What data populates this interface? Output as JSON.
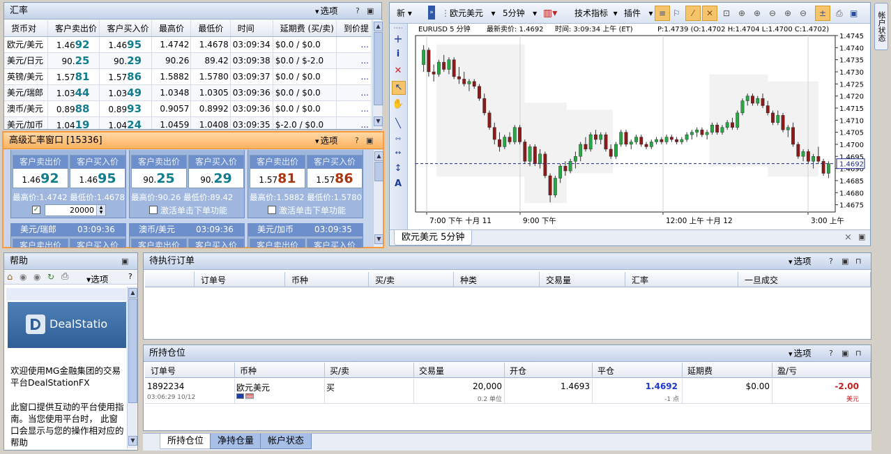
{
  "colors": {
    "accent": "#316ac5",
    "bid_color": "#117d8d",
    "ask_color": "#a83612",
    "bull": "#28a745",
    "bear": "#8b1a1a",
    "advanced_border": "#ff9a3c"
  },
  "rates_panel": {
    "title": "汇率",
    "options": "选项",
    "columns": [
      "货币对",
      "客户卖出价",
      "客户买入价",
      "最高价",
      "最低价",
      "时间",
      "延期费 (买/卖)",
      "到价提"
    ],
    "rows": [
      {
        "pair": "欧元/美元",
        "bid_pre": "1.46",
        "bid_big": "92",
        "ask_pre": "1.46",
        "ask_big": "95",
        "high": "1.4742",
        "low": "1.4678",
        "time": "03:09:34",
        "rollover": "$0.0 / $0.0",
        "alert": "..."
      },
      {
        "pair": "美元/日元",
        "bid_pre": "90.",
        "bid_big": "25",
        "ask_pre": "90.",
        "ask_big": "29",
        "high": "90.26",
        "low": "89.42",
        "time": "03:09:38",
        "rollover": "$0.0 / $-2.0",
        "alert": "..."
      },
      {
        "pair": "英镑/美元",
        "bid_pre": "1.57",
        "bid_big": "81",
        "ask_pre": "1.57",
        "ask_big": "86",
        "high": "1.5882",
        "low": "1.5780",
        "time": "03:09:37",
        "rollover": "$0.0 / $0.0",
        "alert": "..."
      },
      {
        "pair": "美元/瑞郎",
        "bid_pre": "1.03",
        "bid_big": "44",
        "ask_pre": "1.03",
        "ask_big": "49",
        "high": "1.0348",
        "low": "1.0305",
        "time": "03:09:36",
        "rollover": "$0.0 / $0.0",
        "alert": "..."
      },
      {
        "pair": "澳币/美元",
        "bid_pre": "0.89",
        "bid_big": "88",
        "ask_pre": "0.89",
        "ask_big": "93",
        "high": "0.9057",
        "low": "0.8992",
        "time": "03:09:36",
        "rollover": "$0.0 / $0.0",
        "alert": "..."
      },
      {
        "pair": "美元/加币",
        "bid_pre": "1.04",
        "bid_big": "19",
        "ask_pre": "1.04",
        "ask_big": "24",
        "high": "1.0459",
        "low": "1.0408",
        "time": "03:09:35",
        "rollover": "$-2.0 / $0.0",
        "alert": "..."
      }
    ]
  },
  "adv_panel": {
    "title": "高级汇率窗口 [15336]",
    "options": "选项",
    "sell_label": "客户卖出价",
    "buy_label": "客户买入价",
    "tiles": [
      {
        "bid_pre": "1.46",
        "bid_big": "92",
        "ask_pre": "1.46",
        "ask_big": "95",
        "hilo": "最高价:1.4742  最低价:1.4678",
        "checked": true,
        "amount": "20000"
      },
      {
        "bid_pre": "90.",
        "bid_big": "25",
        "ask_pre": "90.",
        "ask_big": "29",
        "hilo": "最高价:90.26  最低价:89.42",
        "checked": false,
        "activate": "激活单击下单功能"
      },
      {
        "bid_pre": "1.57",
        "bid_big": "81",
        "ask_pre": "1.57",
        "ask_big": "86",
        "hilo": "最高价:1.5882  最低价:1.5780",
        "checked": false,
        "activate": "激活单击下单功能"
      }
    ],
    "row2": [
      {
        "pair": "美元/瑞郎",
        "time": "03:09:36"
      },
      {
        "pair": "澳币/美元",
        "time": "03:09:36"
      },
      {
        "pair": "美元/加币",
        "time": "03:09:35"
      }
    ]
  },
  "help_panel": {
    "title": "帮助",
    "options": "选项",
    "logo_text": "DealStatio",
    "para1": "欢迎使用MG金融集团的交易平台DealStationFX",
    "para2": "此窗口提供互动的平台使用指南。当您使用平台时， 此窗口会显示与您的操作相对应的帮助"
  },
  "chart_toolbar": {
    "new": "新",
    "symbol": "欧元美元",
    "interval": "5分钟",
    "indicators": "技术指标",
    "plugins": "插件"
  },
  "chart_data": {
    "type": "candlestick",
    "title": "EURUSD  5 分钟",
    "latest": "最新卖价: 1.4692",
    "time_info": "时间: 3:09:34 上午 (ET)",
    "ohlc_info": "P:1.4739 (O:1.4702 H:1.4704 L:1.4700 C:1.4702)",
    "ylim": [
      1.4672,
      1.4745
    ],
    "yticks": [
      "1.4745",
      "1.4740",
      "1.4735",
      "1.4730",
      "1.4725",
      "1.4720",
      "1.4715",
      "1.4710",
      "1.4705",
      "1.4700",
      "1.4695",
      "1.4690",
      "1.4685",
      "1.4680",
      "1.4675"
    ],
    "current_price": "1.4692",
    "xticks": [
      "7:00 下午 十月 11",
      "9:00 下午",
      "12:00 上午 十月 12",
      "3:00 上午"
    ],
    "candles": [
      [
        1.4733,
        1.4741,
        1.473,
        1.4739
      ],
      [
        1.4739,
        1.474,
        1.4728,
        1.473
      ],
      [
        1.473,
        1.4733,
        1.4726,
        1.4729
      ],
      [
        1.4729,
        1.4735,
        1.4728,
        1.4734
      ],
      [
        1.4734,
        1.4737,
        1.473,
        1.4731
      ],
      [
        1.4731,
        1.4736,
        1.4729,
        1.4735
      ],
      [
        1.4735,
        1.4736,
        1.4727,
        1.4728
      ],
      [
        1.4728,
        1.4732,
        1.4725,
        1.4727
      ],
      [
        1.4727,
        1.473,
        1.4724,
        1.4725
      ],
      [
        1.4725,
        1.4727,
        1.4722,
        1.4726
      ],
      [
        1.4726,
        1.4727,
        1.4723,
        1.4724
      ],
      [
        1.4724,
        1.4725,
        1.4718,
        1.4719
      ],
      [
        1.4719,
        1.4721,
        1.4712,
        1.4713
      ],
      [
        1.4713,
        1.4714,
        1.4706,
        1.4707
      ],
      [
        1.4707,
        1.4709,
        1.47,
        1.4702
      ],
      [
        1.4702,
        1.4705,
        1.4697,
        1.4699
      ],
      [
        1.4699,
        1.4704,
        1.4698,
        1.4703
      ],
      [
        1.4703,
        1.4705,
        1.47,
        1.4701
      ],
      [
        1.4701,
        1.4708,
        1.47,
        1.4707
      ],
      [
        1.4707,
        1.4708,
        1.47,
        1.4701
      ],
      [
        1.4701,
        1.4702,
        1.4692,
        1.4693
      ],
      [
        1.4693,
        1.47,
        1.4691,
        1.4699
      ],
      [
        1.4699,
        1.47,
        1.4691,
        1.4692
      ],
      [
        1.4692,
        1.4698,
        1.469,
        1.4696
      ],
      [
        1.4696,
        1.4697,
        1.4686,
        1.4687
      ],
      [
        1.4687,
        1.4688,
        1.4676,
        1.4679
      ],
      [
        1.4679,
        1.4687,
        1.4678,
        1.4686
      ],
      [
        1.4686,
        1.4692,
        1.4684,
        1.4691
      ],
      [
        1.4691,
        1.4693,
        1.4687,
        1.4689
      ],
      [
        1.4689,
        1.4694,
        1.4688,
        1.4693
      ],
      [
        1.4693,
        1.4697,
        1.469,
        1.4695
      ],
      [
        1.4695,
        1.4701,
        1.4693,
        1.47
      ],
      [
        1.47,
        1.4703,
        1.4697,
        1.4698
      ],
      [
        1.4698,
        1.4705,
        1.4697,
        1.4704
      ],
      [
        1.4704,
        1.4706,
        1.47,
        1.4702
      ],
      [
        1.4702,
        1.4705,
        1.47,
        1.4704
      ],
      [
        1.4704,
        1.4705,
        1.4697,
        1.4698
      ],
      [
        1.4698,
        1.47,
        1.4694,
        1.4695
      ],
      [
        1.4695,
        1.4701,
        1.4694,
        1.47
      ],
      [
        1.47,
        1.4706,
        1.4699,
        1.4705
      ],
      [
        1.4705,
        1.4706,
        1.4699,
        1.47
      ],
      [
        1.47,
        1.4702,
        1.4698,
        1.4701
      ],
      [
        1.4701,
        1.4704,
        1.47,
        1.4703
      ],
      [
        1.4703,
        1.4704,
        1.4699,
        1.47
      ],
      [
        1.47,
        1.4701,
        1.4698,
        1.4699
      ],
      [
        1.4699,
        1.4702,
        1.4698,
        1.4701
      ],
      [
        1.4701,
        1.4703,
        1.47,
        1.4702
      ],
      [
        1.4702,
        1.4703,
        1.47,
        1.4701
      ],
      [
        1.4701,
        1.4704,
        1.47,
        1.4703
      ],
      [
        1.4703,
        1.4704,
        1.4701,
        1.4702
      ],
      [
        1.4702,
        1.4703,
        1.47,
        1.4701
      ],
      [
        1.4701,
        1.4703,
        1.47,
        1.4702
      ],
      [
        1.4702,
        1.4705,
        1.4701,
        1.4704
      ],
      [
        1.4704,
        1.4706,
        1.4702,
        1.4705
      ],
      [
        1.4705,
        1.4707,
        1.4703,
        1.4706
      ],
      [
        1.4706,
        1.4707,
        1.4703,
        1.4704
      ],
      [
        1.4704,
        1.4706,
        1.4702,
        1.4705
      ],
      [
        1.4705,
        1.4709,
        1.4704,
        1.4708
      ],
      [
        1.4708,
        1.4709,
        1.4704,
        1.4705
      ],
      [
        1.4705,
        1.4708,
        1.4704,
        1.4707
      ],
      [
        1.4707,
        1.471,
        1.4706,
        1.4709
      ],
      [
        1.4709,
        1.4711,
        1.4706,
        1.4707
      ],
      [
        1.4707,
        1.4714,
        1.4706,
        1.4713
      ],
      [
        1.4713,
        1.4719,
        1.4712,
        1.4718
      ],
      [
        1.4718,
        1.4721,
        1.4716,
        1.472
      ],
      [
        1.472,
        1.4721,
        1.4716,
        1.4717
      ],
      [
        1.4717,
        1.472,
        1.4716,
        1.4719
      ],
      [
        1.4719,
        1.4721,
        1.4715,
        1.4716
      ],
      [
        1.4716,
        1.4718,
        1.4712,
        1.4713
      ],
      [
        1.4713,
        1.4714,
        1.4708,
        1.4709
      ],
      [
        1.4709,
        1.4714,
        1.4708,
        1.4712
      ],
      [
        1.4712,
        1.4713,
        1.4705,
        1.4706
      ],
      [
        1.4706,
        1.4708,
        1.4703,
        1.4707
      ],
      [
        1.4707,
        1.4709,
        1.4699,
        1.47
      ],
      [
        1.47,
        1.4701,
        1.4694,
        1.4695
      ],
      [
        1.4695,
        1.4698,
        1.4693,
        1.4697
      ],
      [
        1.4697,
        1.4698,
        1.4692,
        1.4693
      ],
      [
        1.4693,
        1.4696,
        1.469,
        1.4695
      ],
      [
        1.4695,
        1.4699,
        1.4692,
        1.4693
      ],
      [
        1.4693,
        1.4694,
        1.4687,
        1.4688
      ],
      [
        1.4688,
        1.4693,
        1.4686,
        1.4692
      ]
    ]
  },
  "chart_tab": "欧元美元 5分钟",
  "orders_panel": {
    "title": "待执行订单",
    "options": "选项",
    "columns": [
      "订单号",
      "币种",
      "买/卖",
      "种类",
      "交易量",
      "汇率",
      "一旦成交"
    ]
  },
  "positions_panel": {
    "title": "所持仓位",
    "options": "选项",
    "columns": [
      "订单号",
      "币种",
      "买/卖",
      "交易量",
      "开仓",
      "平仓",
      "延期费",
      "盈/亏"
    ],
    "row": {
      "order_no": "1892234",
      "timestamp": "03:06:29 10/12",
      "currency": "欧元美元",
      "side": "买",
      "volume": "20,000",
      "units": "0.2 单位",
      "open": "1.4693",
      "close": "1.4692",
      "pips": "-1 点",
      "rollover": "$0.00",
      "pnl": "-2.00",
      "pnl_unit": "美元"
    }
  },
  "bottom_tabs": [
    "所持仓位",
    "净持仓量",
    "帐户状态"
  ],
  "side_tab": "帐户状态"
}
